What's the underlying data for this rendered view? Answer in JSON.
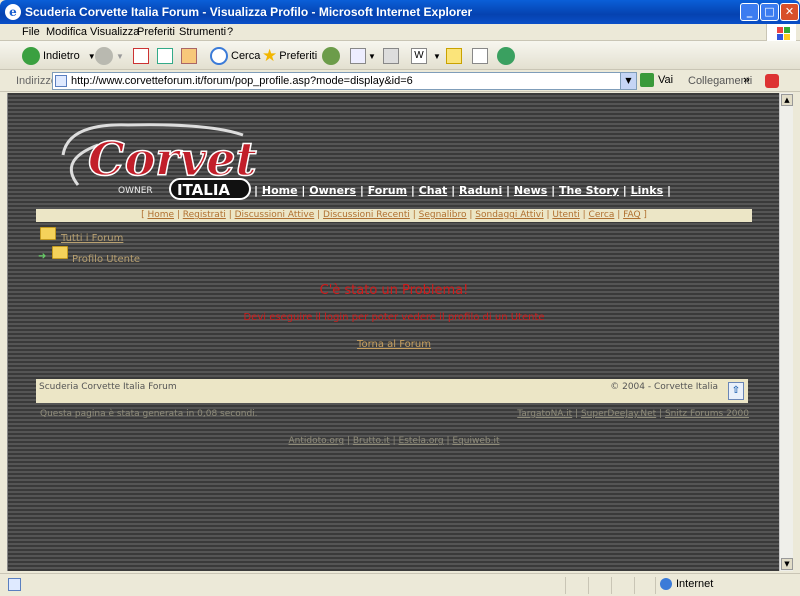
{
  "window": {
    "title": "Scuderia Corvette Italia Forum - Visualizza Profilo - Microsoft Internet Explorer",
    "app_icon": "e"
  },
  "menu": [
    "File",
    "Modifica",
    "Visualizza",
    "Preferiti",
    "Strumenti",
    "?"
  ],
  "toolbar": {
    "back_label": "Indietro",
    "search_label": "Cerca",
    "favorites_label": "Preferiti"
  },
  "address": {
    "label": "Indirizzo",
    "url": "http://www.corvetteforum.it/forum/pop_profile.asp?mode=display&id=6",
    "go_label": "Vai",
    "links_label": "Collegamenti"
  },
  "page": {
    "logo_text": "Corvette",
    "logo_owner": "OWNER",
    "logo_italia": "ITALIA",
    "top_nav": [
      "Home",
      "Owners",
      "Forum",
      "Chat",
      "Raduni",
      "News",
      "The Story",
      "Links"
    ],
    "forum_menu": [
      "Home",
      "Registrati",
      "Discussioni Attive",
      "Discussioni Recenti",
      "Segnalibro",
      "Sondaggi Attivi",
      "Utenti",
      "Cerca",
      "FAQ"
    ],
    "crumb_all": "Tutti i Forum",
    "crumb_profile": "Profilo Utente",
    "error_title": "C'è stato un Problema!",
    "error_message": "Devi eseguire il login per poter vedere il profilo di un Utente",
    "back_link": "Torna al Forum",
    "footer_left": "Scuderia Corvette Italia Forum",
    "footer_right": "© 2004 - Corvette Italia",
    "generated": "Questa pagina è stata generata in 0,08 secondi.",
    "credits": [
      "TargatoNA.it",
      "SuperDeeJay.Net",
      "Snitz Forums 2000"
    ],
    "partners": [
      "Antidoto.org",
      "Brutto.it",
      "Estela.org",
      "Equiweb.it"
    ]
  },
  "status": {
    "zone": "Internet"
  }
}
